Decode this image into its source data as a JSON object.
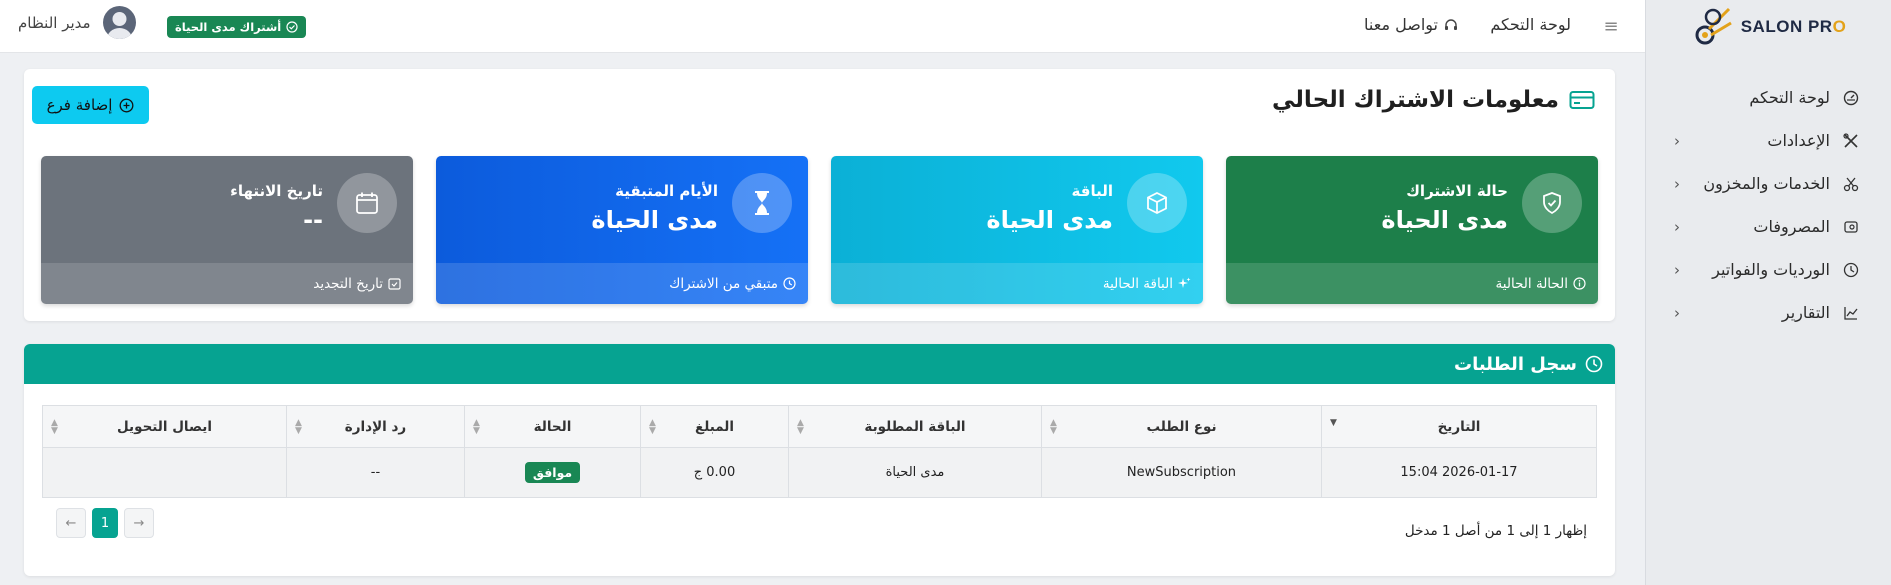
{
  "brand": {
    "logo_part1": "SALON PR",
    "logo_part2": "O"
  },
  "sidebar": {
    "items": [
      {
        "label": "لوحة التحكم",
        "icon": "dashboard-icon",
        "has_chevron": false
      },
      {
        "label": "الإعدادات",
        "icon": "tools-icon",
        "has_chevron": true
      },
      {
        "label": "الخدمات والمخزون",
        "icon": "scissors-icon",
        "has_chevron": true
      },
      {
        "label": "المصروفات",
        "icon": "expenses-icon",
        "has_chevron": true
      },
      {
        "label": "الورديات والفواتير",
        "icon": "clock-icon",
        "has_chevron": true
      },
      {
        "label": "التقارير",
        "icon": "chart-icon",
        "has_chevron": true
      }
    ]
  },
  "topbar": {
    "dashboard_link": "لوحة التحكم",
    "contact_link": "تواصل معنا",
    "user_name": "مدير النظام",
    "lifetime_badge": "أشتراك مدى الحياة"
  },
  "subscription": {
    "title": "معلومات الاشتراك الحالي",
    "add_branch_label": "إضافة فرع",
    "cards": [
      {
        "label": "حالة الاشتراك",
        "value": "مدى الحياة",
        "footer": "الحالة الحالية",
        "icon": "shield-check-icon"
      },
      {
        "label": "الباقة",
        "value": "مدى الحياة",
        "footer": "الباقة الحالية",
        "icon": "box-icon"
      },
      {
        "label": "الأيام المتبقية",
        "value": "مدى الحياة",
        "footer": "متبقي من الاشتراك",
        "icon": "hourglass-icon"
      },
      {
        "label": "تاريخ الانتهاء",
        "value": "--",
        "footer": "تاريخ التجديد",
        "icon": "calendar-icon"
      }
    ]
  },
  "requests_log": {
    "title": "سجل الطلبات",
    "columns": [
      "التاريخ",
      "نوع الطلب",
      "الباقة المطلوبة",
      "المبلغ",
      "الحالة",
      "رد الإدارة",
      "ايصال التحويل"
    ],
    "rows": [
      {
        "date": "2026-01-17 15:04",
        "type": "NewSubscription",
        "package": "مدى الحياة",
        "amount": "0.00 ج",
        "status": "موافق",
        "admin_reply": "--",
        "receipt": ""
      }
    ],
    "info": "إظهار 1 إلى 1 من أصل 1 مدخل",
    "pager": {
      "prev": "←",
      "current": "1",
      "next": "→"
    }
  },
  "colors": {
    "primary_teal": "#06a391",
    "success": "#198754",
    "info": "#0dcaf0",
    "blue": "#0d6efd",
    "gray": "#6c737c"
  }
}
